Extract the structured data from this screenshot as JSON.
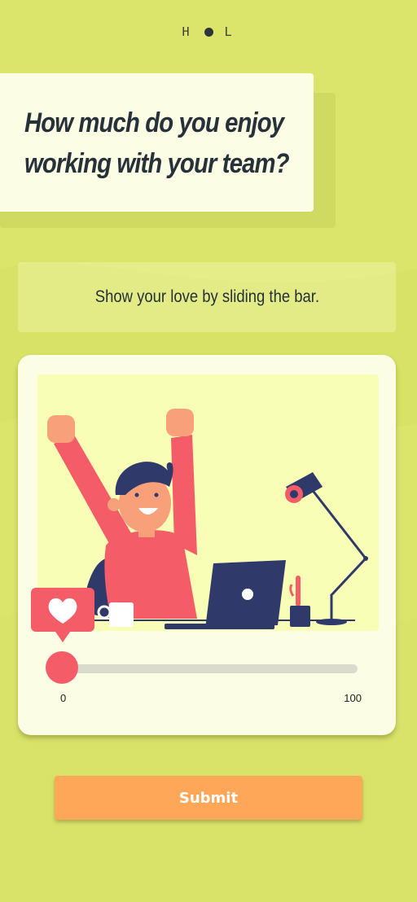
{
  "brand": {
    "logo_left": "H",
    "logo_right": "L"
  },
  "question": {
    "title": "How much do you enjoy working with your team?"
  },
  "hint": {
    "text": "Show your love by sliding the bar."
  },
  "slider": {
    "value": 0,
    "min_label": "0",
    "max_label": "100",
    "min": 0,
    "max": 100
  },
  "submit": {
    "label": "Submit"
  },
  "colors": {
    "background": "#dbe56c",
    "card": "#fbfde4",
    "accent_red": "#f45d68",
    "submit": "#ffa759",
    "navy": "#2f3a6b"
  },
  "icons": {
    "heart": "heart-icon",
    "illustration": "man-at-desk-illustration"
  }
}
